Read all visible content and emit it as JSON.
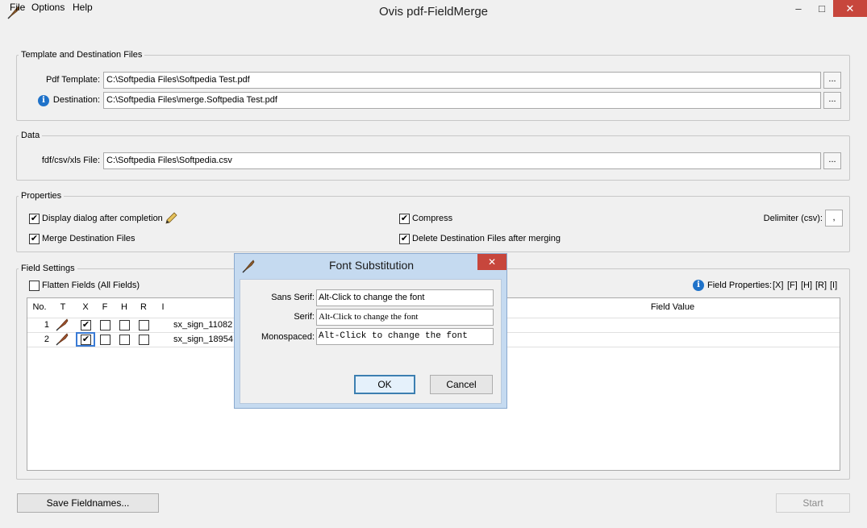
{
  "window": {
    "title": "Ovis pdf-FieldMerge",
    "minimize": "–",
    "maximize": "□",
    "close": "✕"
  },
  "menu": {
    "file": "File",
    "options": "Options",
    "help": "Help"
  },
  "template_group": {
    "title": "Template and Destination Files",
    "pdf_template_label": "Pdf Template:",
    "pdf_template_value": "C:\\Softpedia Files\\Softpedia Test.pdf",
    "destination_label": "Destination:",
    "destination_value": "C:\\Softpedia Files\\merge.Softpedia Test.pdf",
    "browse": "..."
  },
  "data_group": {
    "title": "Data",
    "file_label": "fdf/csv/xls File:",
    "file_value": "C:\\Softpedia Files\\Softpedia.csv",
    "browse": "..."
  },
  "properties": {
    "title": "Properties",
    "display_dialog": "Display dialog after completion",
    "display_dialog_checked": true,
    "merge_destination": "Merge Destination Files",
    "merge_destination_checked": true,
    "compress": "Compress",
    "compress_checked": true,
    "delete_destination": "Delete Destination Files after merging",
    "delete_destination_checked": true,
    "delimiter_label": "Delimiter (csv):",
    "delimiter_value": ","
  },
  "field_settings": {
    "title": "Field Settings",
    "flatten_label": "Flatten Fields (All Fields)",
    "flatten_checked": false,
    "field_properties_label": "Field Properties:",
    "field_property_links": [
      "[X]",
      "[F]",
      "[H]",
      "[R]",
      "[I]"
    ],
    "columns": [
      "No.",
      "T",
      "X",
      "F",
      "H",
      "R",
      "I",
      "Field Value"
    ],
    "rows": [
      {
        "no": "1",
        "name": "sx_sign_11082",
        "x": true,
        "f": false,
        "h": false,
        "r": false
      },
      {
        "no": "2",
        "name": "sx_sign_18954",
        "x": true,
        "f": false,
        "h": false,
        "r": false
      }
    ]
  },
  "buttons": {
    "save_fieldnames": "Save Fieldnames...",
    "start": "Start"
  },
  "dialog": {
    "title": "Font Substitution",
    "close": "✕",
    "sans_serif_label": "Sans Serif:",
    "sans_serif_value": "Alt-Click to change the font",
    "serif_label": "Serif:",
    "serif_value": "Alt-Click to change the font",
    "monospaced_label": "Monospaced:",
    "monospaced_value": "Alt-Click to change the font",
    "ok": "OK",
    "cancel": "Cancel"
  },
  "colors": {
    "close_button": "#c7463c",
    "dialog_frame": "#c5daf0",
    "info_icon": "#1f72c9"
  }
}
